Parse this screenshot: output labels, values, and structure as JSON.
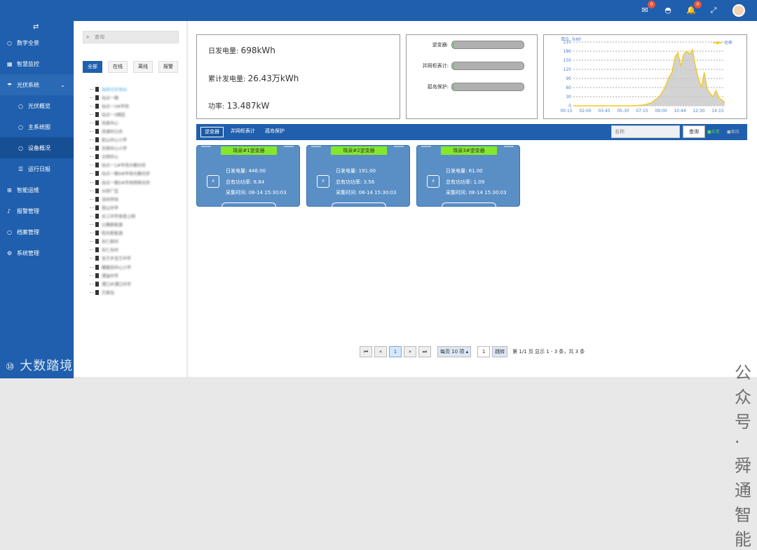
{
  "topbar": {
    "mail_badge": "0",
    "bell_badge": "0"
  },
  "sidebar": {
    "toggle_icon": "⇄",
    "items": [
      {
        "label": "数字全景",
        "icon": "circle-icon"
      },
      {
        "label": "智慧监控",
        "icon": "grid-icon"
      },
      {
        "label": "光伏系统",
        "icon": "umbrella-icon"
      },
      {
        "label": "光伏概览",
        "icon": "circle-icon"
      },
      {
        "label": "主系统图",
        "icon": "circle-icon"
      },
      {
        "label": "设备概况",
        "icon": "circle-icon"
      },
      {
        "label": "运行日报",
        "icon": "list-icon"
      },
      {
        "label": "智能运维",
        "icon": "sitemap-icon"
      },
      {
        "label": "报警管理",
        "icon": "bell-icon"
      },
      {
        "label": "档案管理",
        "icon": "circle-icon"
      },
      {
        "label": "系统管理",
        "icon": "gear-icon"
      }
    ],
    "watermark": "大数踏境"
  },
  "tree_panel": {
    "search_placeholder": "查询",
    "filters": [
      "全部",
      "在线",
      "离线",
      "报警"
    ],
    "nodes": [
      "珠泉光伏电站",
      "站点一期",
      "站点一3#市场",
      "站点一3期区",
      "风景中心",
      "资源村公共",
      "蛇山中心小学",
      "东侧中心小学",
      "文明中心",
      "站点一1#市场大棚光伏",
      "站点一期4#市场大棚光伏",
      "站点一期5#市场西侧光伏",
      "大桥厂区",
      "深圳学校",
      "莲山中学",
      "长三中学食堂上网",
      "公路新能源",
      "阳光新能源",
      "东仁新村",
      "东仁东村",
      "宝王乡宝王中学",
      "蝶屋四中心小学",
      "谭庙中学",
      "谭口乡谭口中学",
      "万家站"
    ]
  },
  "stats": {
    "daily_label": "日发电量:",
    "daily_value": "698kWh",
    "total_label": "累计发电量:",
    "total_value": "26.43万kWh",
    "power_label": "功率:",
    "power_value": "13.487kW"
  },
  "status": {
    "rows": [
      {
        "label": "逆变器:"
      },
      {
        "label": "并网柜表计:"
      },
      {
        "label": "孤岛保护:"
      }
    ]
  },
  "chart_data": {
    "type": "area",
    "unit_label": "单位（kW）",
    "series": [
      {
        "name": "功率"
      }
    ],
    "ylim": [
      0,
      210
    ],
    "yticks": [
      "210",
      "180",
      "150",
      "120",
      "90",
      "60",
      "30",
      "0"
    ],
    "xticks": [
      "00:15",
      "02:00",
      "03:45",
      "05:30",
      "07:15",
      "09:00",
      "10:44",
      "12:30",
      "14:15"
    ],
    "x": [
      0,
      1,
      2,
      3,
      4,
      5,
      6,
      7,
      7.5,
      8,
      8.3,
      8.6,
      8.9,
      9.2,
      9.5,
      9.8,
      10.1,
      10.4,
      10.7,
      11,
      11.3,
      11.6,
      11.9,
      12.2,
      12.5,
      12.8,
      13.1,
      13.4,
      13.7,
      14,
      14.3,
      14.6,
      14.9,
      15.2,
      15.5
    ],
    "values": [
      0,
      0,
      0,
      0,
      0,
      0,
      0,
      2,
      5,
      10,
      18,
      25,
      35,
      50,
      70,
      95,
      110,
      160,
      175,
      130,
      170,
      180,
      170,
      185,
      130,
      90,
      60,
      110,
      55,
      40,
      30,
      50,
      25,
      20,
      10
    ]
  },
  "tabs": {
    "items": [
      "逆变器",
      "并网柜表计",
      "孤岛保护"
    ],
    "name_placeholder": "名称",
    "query": "查询",
    "legend_normal": "正常",
    "legend_offline": "离线"
  },
  "inverters": [
    {
      "title": "珠泉#1逆变器",
      "daily": "日发电量: 446.00",
      "power": "总有功功率: 8.84",
      "time": "采集时间: 08-14 15:30:03"
    },
    {
      "title": "珠泉#2逆变器",
      "daily": "日发电量: 191.00",
      "power": "总有功功率: 3.56",
      "time": "采集时间: 08-14 15:30:03"
    },
    {
      "title": "珠泉3#逆变器",
      "daily": "日发电量: 61.00",
      "power": "总有功功率: 1.09",
      "time": "采集时间: 08-14 15:30:03"
    }
  ],
  "pager": {
    "page": "1",
    "per_page": "每页 10 项 ▴",
    "goto_value": "1",
    "jump": "跳转",
    "info": "第 1/1 页 显示 1 - 3 条，共 3 条"
  },
  "watermark2": "公众号 · 舜通智能"
}
